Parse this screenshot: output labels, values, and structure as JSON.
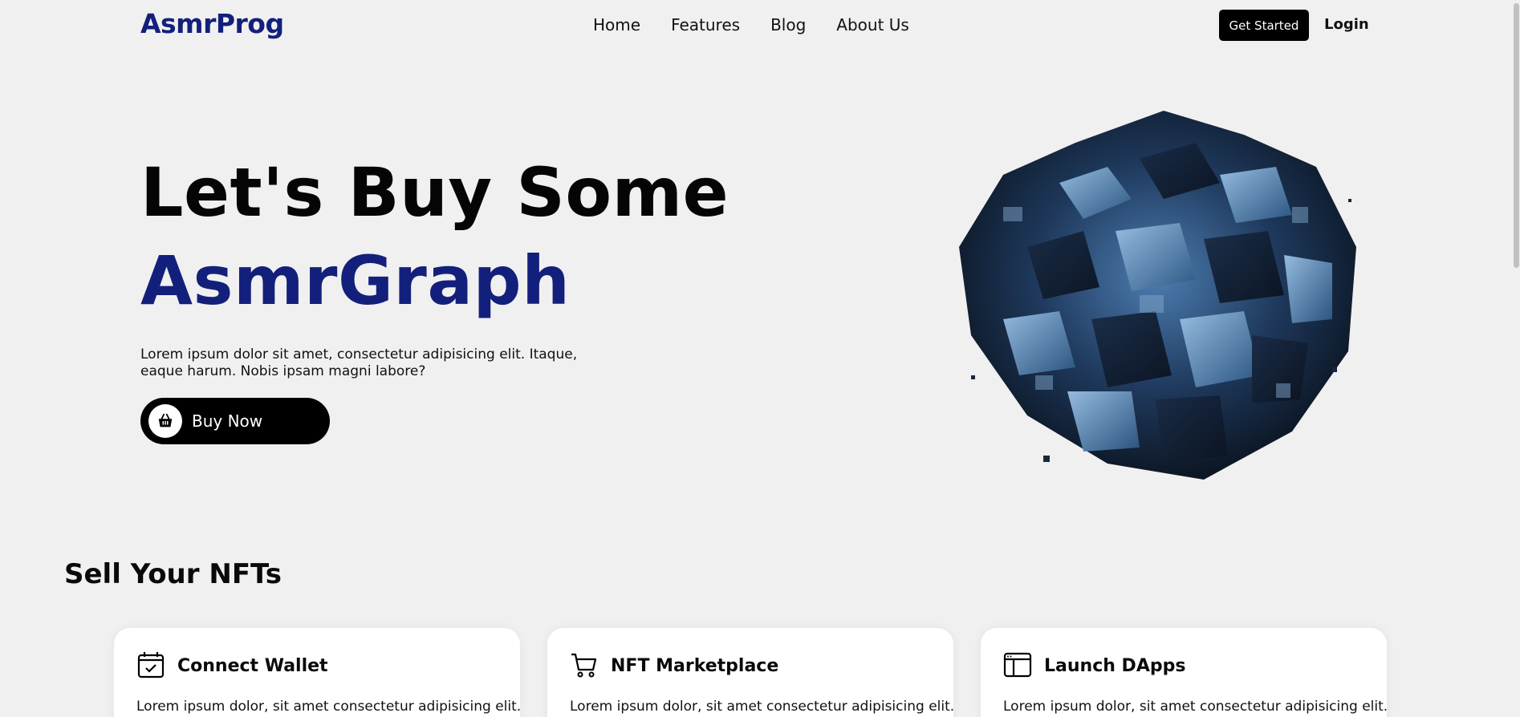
{
  "header": {
    "logo": "AsmrProg",
    "nav_items": [
      {
        "label": "Home"
      },
      {
        "label": "Features"
      },
      {
        "label": "Blog"
      },
      {
        "label": "About Us"
      }
    ],
    "cta_label": "Get Started",
    "login_label": "Login"
  },
  "hero": {
    "title_line1": "Let's Buy Some",
    "title_line2": "AsmrGraph",
    "description": "Lorem ipsum dolor sit amet, consectetur adipisicing elit. Itaque, eaque harum. Nobis ipsam magni labore?",
    "buy_label": "Buy Now",
    "buy_icon": "basket-icon",
    "image_name": "abstract-cube-sphere-image"
  },
  "section": {
    "title": "Sell Your NFTs",
    "cards": [
      {
        "title": "Connect Wallet",
        "icon": "calendar-check-icon",
        "text": "Lorem ipsum dolor, sit amet consectetur adipisicing elit."
      },
      {
        "title": "NFT Marketplace",
        "icon": "cart-icon",
        "text": "Lorem ipsum dolor, sit amet consectetur adipisicing elit."
      },
      {
        "title": "Launch DApps",
        "icon": "browser-layout-icon",
        "text": "Lorem ipsum dolor, sit amet consectetur adipisicing elit."
      }
    ]
  },
  "colors": {
    "brand": "#13207b",
    "background": "#f0f0f0",
    "button": "#000000",
    "card": "#ffffff"
  }
}
